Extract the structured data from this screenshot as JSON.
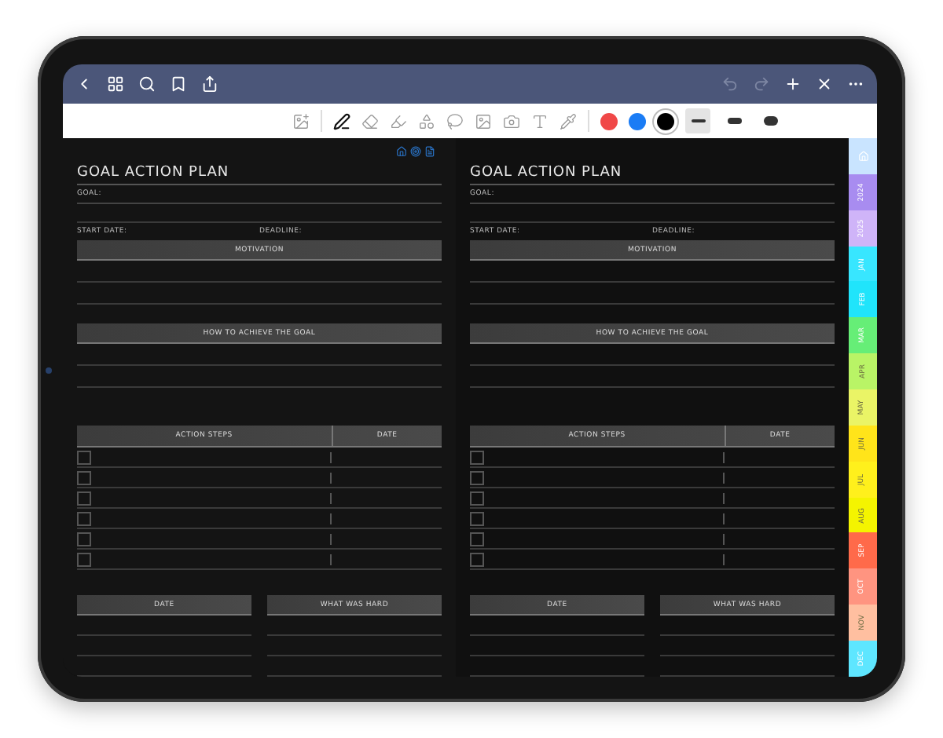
{
  "navbar": {
    "left": [
      {
        "kind": "back"
      },
      {
        "kind": "grid"
      },
      {
        "kind": "search"
      },
      {
        "kind": "bookmark"
      },
      {
        "kind": "share"
      }
    ],
    "right": [
      {
        "kind": "undo",
        "disabled": true
      },
      {
        "kind": "redo",
        "disabled": true
      },
      {
        "kind": "add",
        "disabled": false
      },
      {
        "kind": "close",
        "disabled": false
      },
      {
        "kind": "more",
        "disabled": false
      }
    ]
  },
  "toolbar": {
    "tools": [
      {
        "kind": "sticker",
        "selected": false
      },
      {
        "kind": "pen",
        "selected": true
      },
      {
        "kind": "eraser",
        "selected": false
      },
      {
        "kind": "highlighter",
        "selected": false
      },
      {
        "kind": "shapes",
        "selected": false
      },
      {
        "kind": "lasso",
        "selected": false
      },
      {
        "kind": "image",
        "selected": false
      },
      {
        "kind": "camera",
        "selected": false
      },
      {
        "kind": "text",
        "selected": false
      },
      {
        "kind": "pipette",
        "selected": false
      }
    ],
    "colors": [
      {
        "color": "#f04848",
        "selected": false
      },
      {
        "color": "#1a7cf5",
        "selected": false
      },
      {
        "color": "#000000",
        "selected": true
      }
    ],
    "strokes": [
      {
        "selected": true
      },
      {
        "selected": false
      },
      {
        "selected": false
      }
    ]
  },
  "pages": [
    {
      "nav_icons": true,
      "title": "GOAL ACTION PLAN",
      "goal_label": "GOAL:",
      "start_label": "START DATE:",
      "deadline_label": "DEADLINE:",
      "motivation": "MOTIVATION",
      "how_to": "HOW TO ACHIEVE THE GOAL",
      "steps_header": "ACTION STEPS",
      "steps_date": "DATE",
      "steps": [
        {
          "checked": false
        },
        {
          "checked": false
        },
        {
          "checked": false
        },
        {
          "checked": false
        },
        {
          "checked": false
        },
        {
          "checked": false
        }
      ],
      "bottom_left": "DATE",
      "bottom_right": "WHAT WAS HARD"
    },
    {
      "nav_icons": false,
      "title": "GOAL ACTION PLAN",
      "goal_label": "GOAL:",
      "start_label": "START DATE:",
      "deadline_label": "DEADLINE:",
      "motivation": "MOTIVATION",
      "how_to": "HOW TO ACHIEVE THE GOAL",
      "steps_header": "ACTION STEPS",
      "steps_date": "DATE",
      "steps": [
        {
          "checked": false
        },
        {
          "checked": false
        },
        {
          "checked": false
        },
        {
          "checked": false
        },
        {
          "checked": false
        },
        {
          "checked": false
        }
      ],
      "bottom_left": "DATE",
      "bottom_right": "WHAT WAS HARD"
    }
  ],
  "side_tabs": [
    {
      "kind": "home",
      "color": "#c9e4ff"
    },
    {
      "kind": "label",
      "label": "2024",
      "color": "#a88cf0"
    },
    {
      "kind": "label",
      "label": "2025",
      "color": "#cfb4f8"
    },
    {
      "kind": "label",
      "label": "JAN",
      "color": "#38e6ff"
    },
    {
      "kind": "label",
      "label": "FEB",
      "color": "#20e4fb"
    },
    {
      "kind": "label",
      "label": "MAR",
      "color": "#66ee77"
    },
    {
      "kind": "label",
      "label": "APR",
      "color": "#b9f466"
    },
    {
      "kind": "label",
      "label": "MAY",
      "color": "#eaf466"
    },
    {
      "kind": "label",
      "label": "JUN",
      "color": "#ffe41a"
    },
    {
      "kind": "label",
      "label": "JUL",
      "color": "#fff01c"
    },
    {
      "kind": "label",
      "label": "AUG",
      "color": "#f4f400"
    },
    {
      "kind": "label",
      "label": "SEP",
      "color": "#ff6a4a"
    },
    {
      "kind": "label",
      "label": "OCT",
      "color": "#ff9480"
    },
    {
      "kind": "label",
      "label": "NOV",
      "color": "#ffbfa0"
    },
    {
      "kind": "label",
      "label": "DEC",
      "color": "#5ee6ff"
    }
  ]
}
